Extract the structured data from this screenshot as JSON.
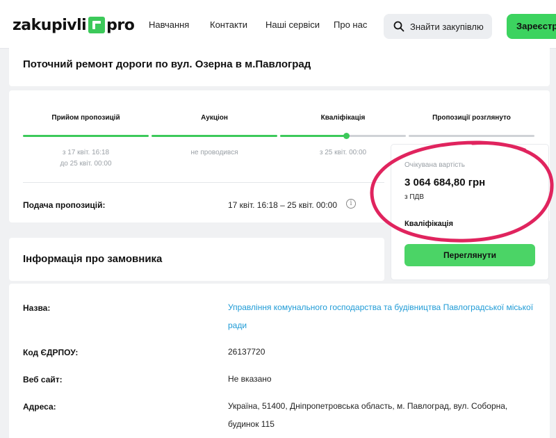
{
  "header": {
    "logo_left": "zakupivli",
    "logo_right": "pro",
    "nav": [
      "Навчання",
      "Контакти",
      "Наші сервіси",
      "Про нас"
    ],
    "search_label": "Знайти закупівлю",
    "register_label": "Зареєструватися"
  },
  "page_title": "Поточний ремонт дороги по вул. Озерна в м.Павлоград",
  "stages": [
    {
      "label": "Прийом пропозицій",
      "date_line1": "з 17 квіт. 16:18",
      "date_line2": "до 25 квіт. 00:00"
    },
    {
      "label": "Аукціон",
      "date_line1": "не проводився",
      "date_line2": ""
    },
    {
      "label": "Кваліфікація",
      "date_line1": "з 25 квіт. 00:00",
      "date_line2": ""
    },
    {
      "label": "Пропозиції розглянуто",
      "date_line1": "",
      "date_line2": ""
    }
  ],
  "submission": {
    "label": "Подача пропозицій:",
    "value": "17 квіт. 16:18 – 25 квіт. 00:00",
    "info_symbol": "i"
  },
  "price": {
    "label": "Очікувана вартість",
    "value": "3 064 684,80 грн",
    "vat": "з ПДВ",
    "status": "Кваліфікація",
    "button": "Переглянути"
  },
  "customer": {
    "title": "Інформація про замовника",
    "rows": [
      {
        "label": "Назва:",
        "value": "Управління комунального господарства та будівництва Павлоградської міської ради"
      },
      {
        "label": "Код ЄДРПОУ:",
        "value": "26137720"
      },
      {
        "label": "Веб сайт:",
        "value": "Не вказано"
      },
      {
        "label": "Адреса:",
        "value": "Україна, 51400, Дніпропетровська область, м. Павлоград, вул. Соборна, будинок 115"
      }
    ]
  },
  "colors": {
    "accent_green": "#3cd35f",
    "link_blue": "#1f9bd6",
    "highlight_red": "#e0245e"
  }
}
